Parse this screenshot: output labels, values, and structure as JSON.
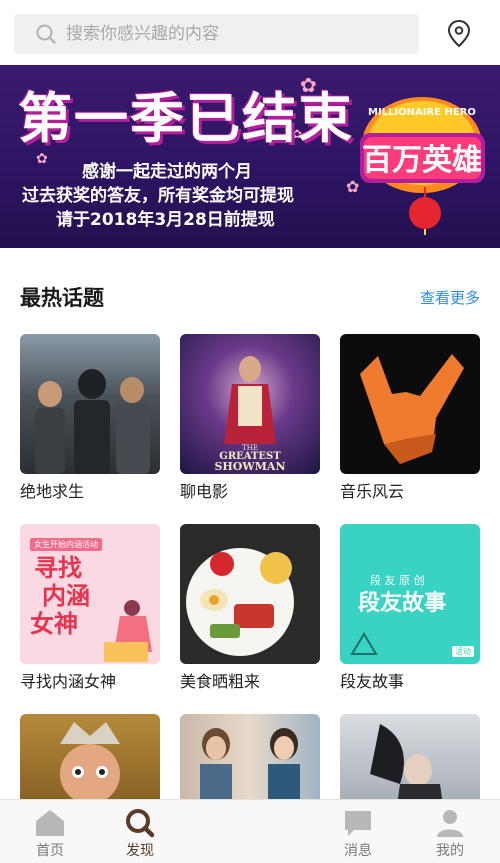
{
  "search": {
    "placeholder": "搜索你感兴趣的内容"
  },
  "banner": {
    "title": "第一季已结束",
    "line1": "感谢一起走过的两个月",
    "line2": "过去获奖的答友，所有奖金均可提现",
    "line3": "请于2018年3月28日前提现",
    "logo_top": "MILLIONAIRE HERO",
    "logo_main": "百万英雄"
  },
  "section": {
    "title": "最热话题",
    "more": "查看更多"
  },
  "topics": [
    {
      "label": "绝地求生"
    },
    {
      "label": "聊电影",
      "poster_text_1": "THE",
      "poster_text_2": "GREATEST",
      "poster_text_3": "SHOWMAN"
    },
    {
      "label": "音乐风云"
    },
    {
      "label": "寻找内涵女神",
      "art_text_top": "女生开始内涵活动",
      "art_text": [
        "寻找",
        "内涵",
        "女神"
      ]
    },
    {
      "label": "美食晒粗来"
    },
    {
      "label": "段友故事",
      "art_text_small": "段 友 原 创",
      "art_text": "段友故事",
      "art_badge": "活动"
    },
    {
      "label": ""
    },
    {
      "label": ""
    },
    {
      "label": ""
    }
  ],
  "tabs": [
    {
      "label": "首页",
      "icon": "home-icon"
    },
    {
      "label": "发现",
      "icon": "discover-search-icon",
      "active": true
    },
    {
      "label": "消息",
      "icon": "message-icon"
    },
    {
      "label": "我的",
      "icon": "profile-icon"
    }
  ],
  "colors": {
    "accent_blue": "#2b8ce6",
    "active_tab": "#5a3b26",
    "banner_bg": "#2d1563"
  }
}
